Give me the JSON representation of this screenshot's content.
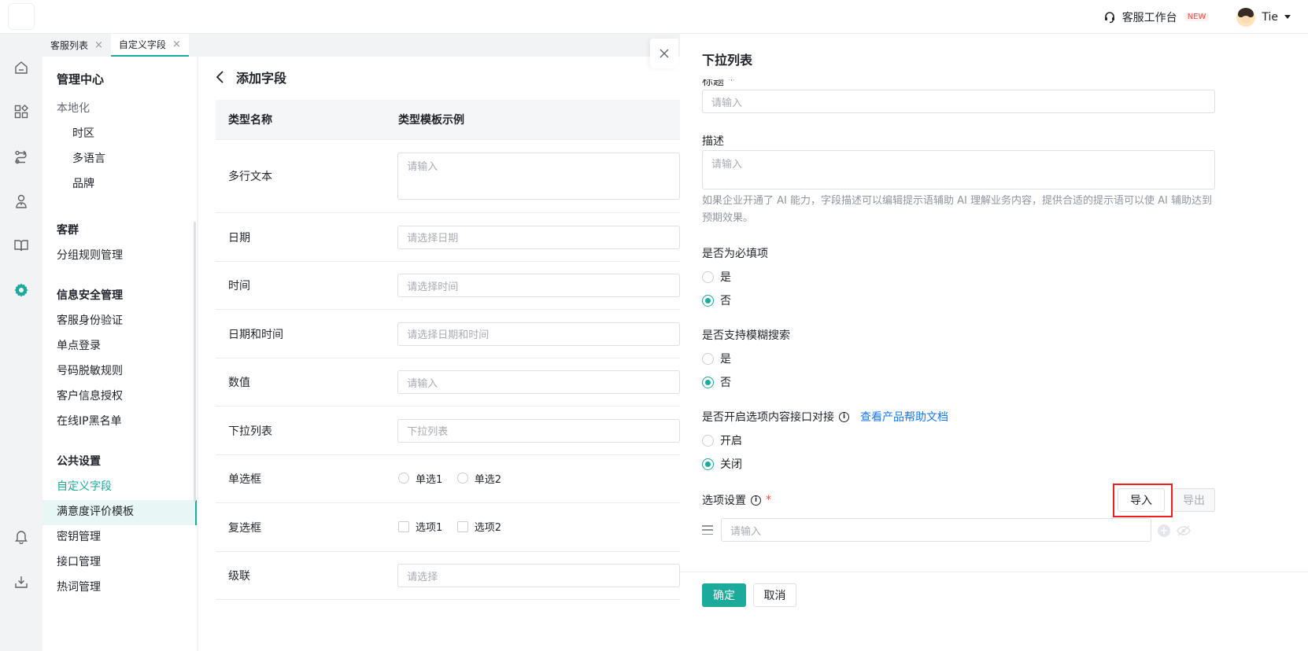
{
  "header": {
    "workbench_label": "客服工作台",
    "workbench_badge": "NEW",
    "user_name": "Tie"
  },
  "rail": {
    "icons": [
      "home-icon",
      "apps-icon",
      "route-icon",
      "agent-icon",
      "book-icon",
      "settings-icon",
      "bell-icon",
      "download-icon"
    ]
  },
  "tabs": [
    {
      "label": "客服列表",
      "close": "×"
    },
    {
      "label": "自定义字段",
      "close": "×"
    }
  ],
  "sidebar": {
    "title": "管理中心",
    "localization": "本地化",
    "timezone": "时区",
    "multilang": "多语言",
    "brand": "品牌",
    "group_customer": "客群",
    "group_rules": "分组规则管理",
    "group_security": "信息安全管理",
    "identity": "客服身份验证",
    "sso": "单点登录",
    "masking": "号码脱敏规则",
    "auth": "客户信息授权",
    "blacklist": "在线IP黑名单",
    "group_public": "公共设置",
    "custom_fields": "自定义字段",
    "satisfaction": "满意度评价模板",
    "keys": "密钥管理",
    "api": "接口管理",
    "hotwords": "热词管理"
  },
  "main": {
    "title": "添加字段",
    "col1": "类型名称",
    "col2": "类型模板示例",
    "rows": [
      {
        "name": "多行文本",
        "placeholder": "请输入"
      },
      {
        "name": "日期",
        "placeholder": "请选择日期"
      },
      {
        "name": "时间",
        "placeholder": "请选择时间"
      },
      {
        "name": "日期和时间",
        "placeholder": "请选择日期和时间"
      },
      {
        "name": "数值",
        "placeholder": "请输入"
      },
      {
        "name": "下拉列表",
        "placeholder": "下拉列表"
      },
      {
        "name": "单选框",
        "opt1": "单选1",
        "opt2": "单选2"
      },
      {
        "name": "复选框",
        "opt1": "选项1",
        "opt2": "选项2"
      },
      {
        "name": "级联",
        "placeholder": "请选择"
      }
    ]
  },
  "drawer": {
    "title": "下拉列表",
    "field_title_label": "标题",
    "required_mark": "*",
    "title_placeholder": "请输入",
    "desc_label": "描述",
    "desc_placeholder": "请输入",
    "desc_help": "如果企业开通了 AI 能力，字段描述可以编辑提示语辅助 AI 理解业务内容，提供合适的提示语可以使 AI 辅助达到预期效果。",
    "required_label": "是否为必填项",
    "yes": "是",
    "no": "否",
    "fuzzy_label": "是否支持模糊搜索",
    "api_label": "是否开启选项内容接口对接",
    "help_link": "查看产品帮助文档",
    "on": "开启",
    "off": "关闭",
    "options_label": "选项设置",
    "import": "导入",
    "export": "导出",
    "option_placeholder": "请输入",
    "confirm": "确定",
    "cancel": "取消"
  },
  "colors": {
    "accent": "#1cab9b",
    "link": "#1677ff",
    "required": "#f54a45",
    "highlight": "#f01e1e"
  }
}
